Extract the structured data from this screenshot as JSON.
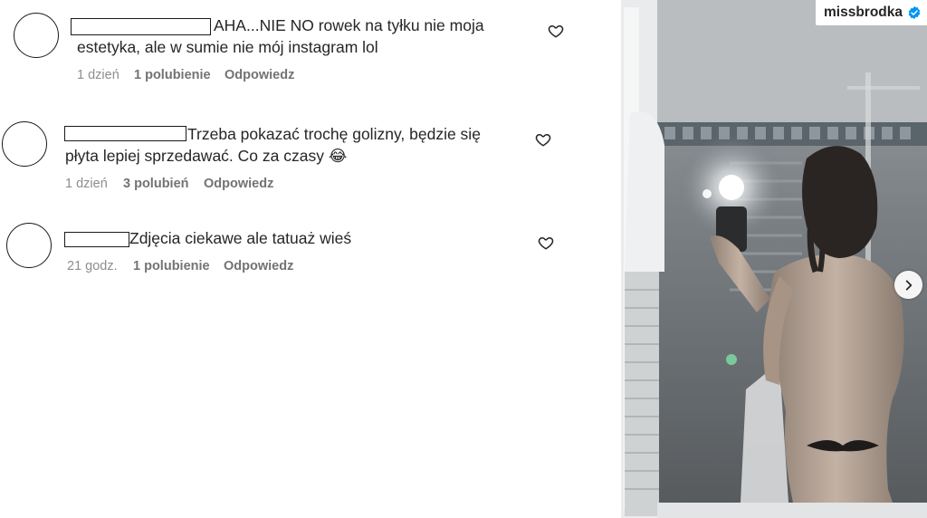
{
  "comments": [
    {
      "text_line1": "AHA...NIE NO rowek na tyłku nie moja",
      "text_line2": "estetyka, ale w sumie nie mój instagram lol",
      "time": "1 dzień",
      "likes": "1 polubienie",
      "reply": "Odpowiedz"
    },
    {
      "text_line1": "Trzeba pokazać trochę golizny, będzie się",
      "text_line2": "płyta lepiej sprzedawać. Co za czasy 😂",
      "time": "1 dzień",
      "likes": "3 polubień",
      "reply": "Odpowiedz"
    },
    {
      "text_line1": "Zdjęcia ciekawe ale tatuaż wieś",
      "time": "21 godz.",
      "likes": "1 polubienie",
      "reply": "Odpowiedz"
    }
  ],
  "post": {
    "username": "missbrodka",
    "verified_icon": "verified-badge-icon",
    "next_icon": "chevron-right-icon"
  },
  "colors": {
    "text": "#262626",
    "meta": "#8e8e8e",
    "verified": "#0095f6"
  }
}
